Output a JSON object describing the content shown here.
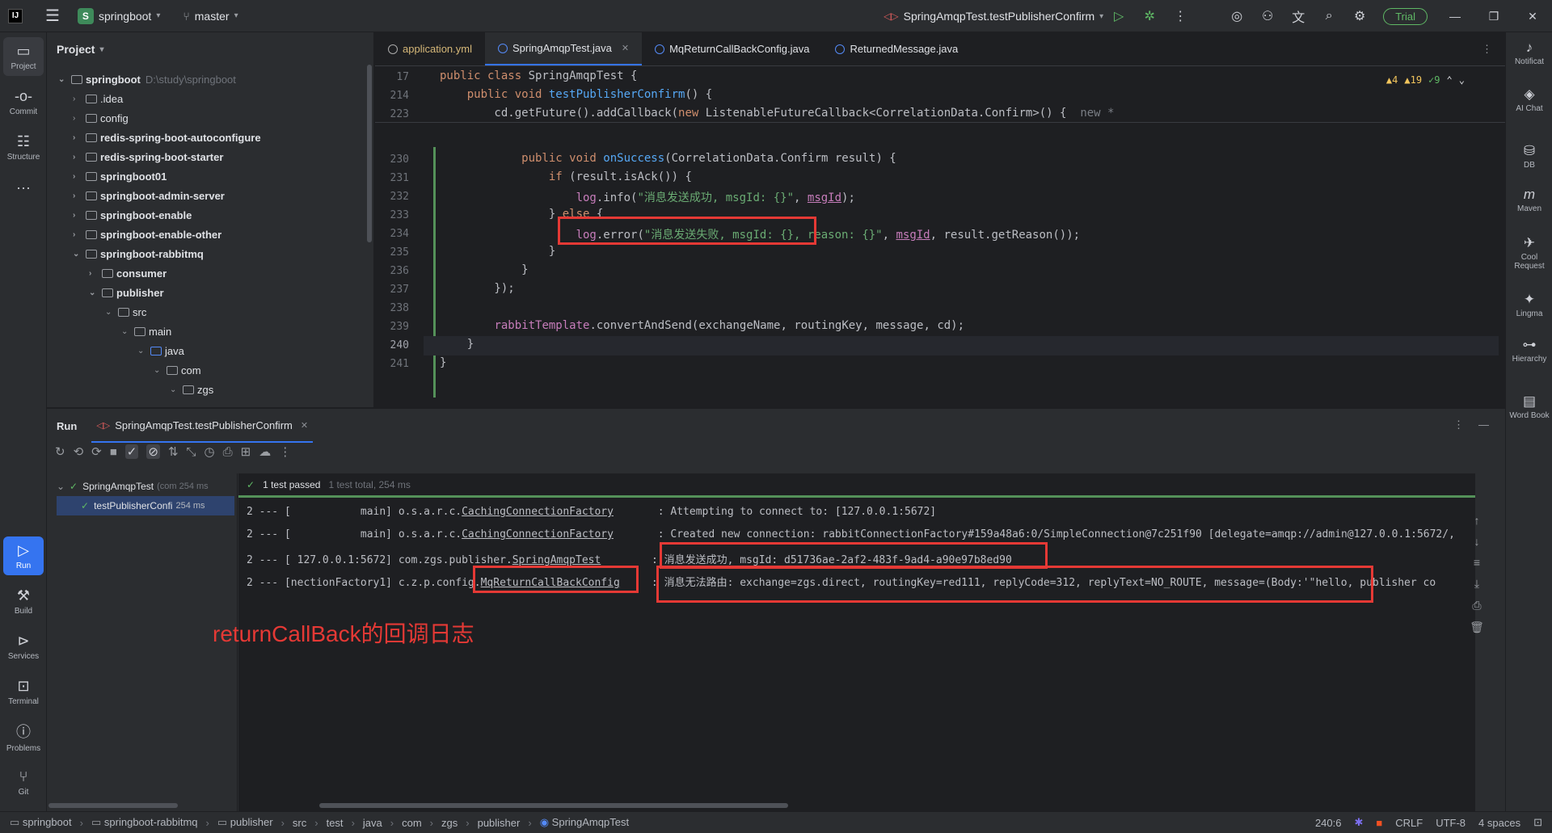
{
  "titlebar": {
    "logo": "IJ",
    "project_badge": "S",
    "project_name": "springboot",
    "branch": "master",
    "run_config": "SpringAmqpTest.testPublisherConfirm",
    "trial": "Trial"
  },
  "leftstrip": [
    {
      "label": "Project",
      "icon": "folder-icon"
    },
    {
      "label": "Commit",
      "icon": "commit-icon"
    },
    {
      "label": "Structure",
      "icon": "structure-icon"
    },
    {
      "label": "Run",
      "icon": "run-icon"
    },
    {
      "label": "Build",
      "icon": "build-icon"
    },
    {
      "label": "Services",
      "icon": "services-icon"
    },
    {
      "label": "Terminal",
      "icon": "terminal-icon"
    },
    {
      "label": "Problems",
      "icon": "problems-icon"
    },
    {
      "label": "Git",
      "icon": "git-icon"
    }
  ],
  "project": {
    "title": "Project",
    "tree": [
      {
        "label": "springboot",
        "path": "D:\\study\\springboot",
        "expanded": true
      },
      {
        "label": ".idea"
      },
      {
        "label": "config"
      },
      {
        "label": "redis-spring-boot-autoconfigure"
      },
      {
        "label": "redis-spring-boot-starter"
      },
      {
        "label": "springboot01"
      },
      {
        "label": "springboot-admin-server"
      },
      {
        "label": "springboot-enable"
      },
      {
        "label": "springboot-enable-other"
      },
      {
        "label": "springboot-rabbitmq",
        "expanded": true
      },
      {
        "label": "consumer"
      },
      {
        "label": "publisher",
        "expanded": true
      },
      {
        "label": "src",
        "expanded": true
      },
      {
        "label": "main",
        "expanded": true
      },
      {
        "label": "java",
        "expanded": true
      },
      {
        "label": "com",
        "expanded": true
      },
      {
        "label": "zgs",
        "expanded": true
      }
    ]
  },
  "editor": {
    "tabs": [
      {
        "label": "application.yml"
      },
      {
        "label": "SpringAmqpTest.java",
        "active": true
      },
      {
        "label": "MqReturnCallBackConfig.java"
      },
      {
        "label": "ReturnedMessage.java"
      }
    ],
    "inspections": {
      "warnings": "4",
      "weak": "19",
      "ok": "9"
    },
    "sticky": [
      {
        "ln": "17",
        "code": "public class SpringAmqpTest {"
      },
      {
        "ln": "214",
        "code": "    public void testPublisherConfirm() {"
      },
      {
        "ln": "223",
        "code": "        cd.getFuture().addCallback(new ListenableFutureCallback<CorrelationData.Confirm>() {",
        "hint": "new *"
      }
    ],
    "lines": [
      {
        "ln": "230",
        "code": "            public void onSuccess(CorrelationData.Confirm result) {"
      },
      {
        "ln": "231",
        "code": "                if (result.isAck()) {"
      },
      {
        "ln": "232",
        "code": "                    log.info(\"消息发送成功, msgId: {}\", msgId);"
      },
      {
        "ln": "233",
        "code": "                } else {"
      },
      {
        "ln": "234",
        "code": "                    log.error(\"消息发送失败, msgId: {}, reason: {}\", msgId, result.getReason());"
      },
      {
        "ln": "235",
        "code": "                }"
      },
      {
        "ln": "236",
        "code": "            }"
      },
      {
        "ln": "237",
        "code": "        });"
      },
      {
        "ln": "238",
        "code": ""
      },
      {
        "ln": "239",
        "code": "        rabbitTemplate.convertAndSend(exchangeName, routingKey, message, cd);"
      },
      {
        "ln": "240",
        "code": "    }"
      },
      {
        "ln": "241",
        "code": "}"
      }
    ]
  },
  "rightstrip": [
    {
      "label": "Notificat",
      "icon": "bell-icon"
    },
    {
      "label": "AI Chat",
      "icon": "ai-chat-icon"
    },
    {
      "label": "DB",
      "icon": "database-icon"
    },
    {
      "label": "Maven",
      "icon": "maven-icon"
    },
    {
      "label": "Cool Request",
      "icon": "cool-request-icon"
    },
    {
      "label": "Lingma",
      "icon": "lingma-icon"
    },
    {
      "label": "Hierarchy",
      "icon": "hierarchy-icon"
    },
    {
      "label": "Word Book",
      "icon": "word-book-icon"
    }
  ],
  "run": {
    "title": "Run",
    "tab": "SpringAmqpTest.testPublisherConfirm",
    "tests": [
      {
        "label": "SpringAmqpTest",
        "detail": "(com 254 ms"
      },
      {
        "label": "testPublisherConfi",
        "detail": "254 ms"
      }
    ],
    "summary": "1 test passed",
    "summary_detail": "1 test total, 254 ms",
    "console": [
      {
        "prefix": "2 --- [           main] o.s.a.r.c.",
        "cls": "CachingConnectionFactory",
        "pad": "       ",
        "msg": ": Attempting to connect to: [127.0.0.1:5672]"
      },
      {
        "prefix": "2 --- [           main] o.s.a.r.c.",
        "cls": "CachingConnectionFactory",
        "pad": "       ",
        "msg": ": Created new connection: rabbitConnectionFactory#159a48a6:0/SimpleConnection@7c251f90 [delegate=amqp://admin@127.0.0.1:5672/,"
      },
      {
        "prefix": "2 --- [ 127.0.0.1:5672] com.zgs.publisher.",
        "cls": "SpringAmqpTest",
        "pad": "        ",
        "msg": ": 消息发送成功, msgId: d51736ae-2af2-483f-9ad4-a90e97b8ed90"
      },
      {
        "prefix": "2 --- [nectionFactory1] c.z.p.config.",
        "cls": "MqReturnCallBackConfig",
        "pad": "     ",
        "msg": ": 消息无法路由: exchange=zgs.direct, routingKey=red111, replyCode=312, replyText=NO_ROUTE, message=(Body:'\"hello, publisher co"
      }
    ],
    "annotation": "returnCallBack的回调日志"
  },
  "statusbar": {
    "crumbs": [
      "springboot",
      "springboot-rabbitmq",
      "publisher",
      "src",
      "test",
      "java",
      "com",
      "zgs",
      "publisher",
      "SpringAmqpTest"
    ],
    "position": "240:6",
    "line_sep": "CRLF",
    "encoding": "UTF-8",
    "indent": "4 spaces"
  }
}
